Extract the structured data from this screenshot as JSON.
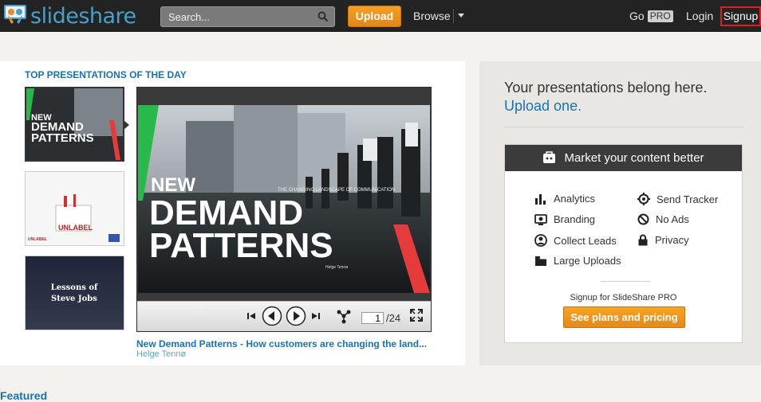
{
  "header": {
    "logo_text": "slideshare",
    "search_placeholder": "Search...",
    "upload_label": "Upload",
    "browse_label": "Browse",
    "go_label": "Go",
    "pro_badge": "PRO",
    "login_label": "Login",
    "signup_label": "Signup"
  },
  "top_presentations": {
    "section_title": "TOP PRESENTATIONS OF THE DAY",
    "thumbnails": [
      {
        "line1": "NEW",
        "line2": "DEMAND",
        "line3": "PATTERNS"
      },
      {
        "line1": "UNLABEL",
        "line2": "UNLABEL"
      },
      {
        "line1": "Lessons of",
        "line2": "Steve Jobs"
      }
    ],
    "slide": {
      "title_line1": "NEW",
      "title_line2": "DEMAND",
      "title_line3": "PATTERNS",
      "subtitle": "THE CHANGING LANDSCAPE OF COMMUNICATION",
      "author": "Helge Tennø"
    },
    "player": {
      "current_page": "1",
      "total_pages": "/24"
    },
    "featured_title": "New Demand Patterns - How customers are changing the land...",
    "featured_author": "Helge Tennø"
  },
  "promo": {
    "line1": "Your presentations belong here.",
    "line2": "Upload one.",
    "market_title": "Market your content better",
    "features": [
      {
        "label": "Analytics",
        "icon": "analytics-icon"
      },
      {
        "label": "Send Tracker",
        "icon": "send-tracker-icon"
      },
      {
        "label": "Branding",
        "icon": "branding-icon"
      },
      {
        "label": "No Ads",
        "icon": "no-ads-icon"
      },
      {
        "label": "Collect Leads",
        "icon": "collect-leads-icon"
      },
      {
        "label": "Privacy",
        "icon": "lock-icon"
      },
      {
        "label": "Large Uploads",
        "icon": "folder-icon"
      }
    ],
    "signup_pro_text": "Signup for SlideShare PRO",
    "plans_button": "See plans and pricing"
  },
  "featured_section": "Featured",
  "colors": {
    "accent_orange": "#f39c1f",
    "link_blue": "#1a73ae",
    "header_bg": "#232323"
  }
}
